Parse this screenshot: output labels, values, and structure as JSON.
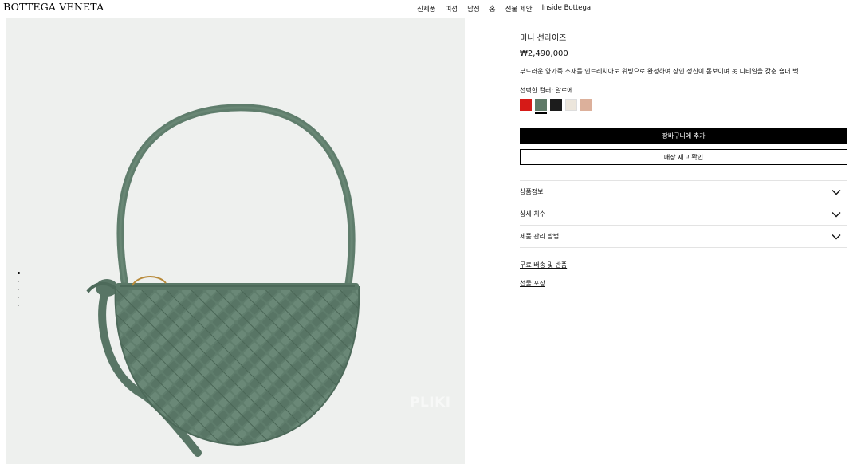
{
  "header": {
    "logo": "BOTTEGA VENETA",
    "nav": [
      "신제품",
      "여성",
      "남성",
      "홈",
      "선물 제안",
      "Inside Bottega"
    ]
  },
  "gallery": {
    "watermark": "PLIKI",
    "slide_count": 5,
    "active_slide": 1
  },
  "product": {
    "name": "미니 선라이즈",
    "price": "₩2,490,000",
    "description": "부드러운 양가죽 소재를 인트레치아토 위빙으로 완성하여 장인 정신이 돋보이며 놋 디테일을 갖춘 숄더 백.",
    "selected_color_label": "선택한 컬러: 알로에",
    "swatches": [
      {
        "name": "red",
        "color": "#d61a17",
        "selected": false
      },
      {
        "name": "aloe",
        "color": "#5f7a68",
        "selected": true
      },
      {
        "name": "black",
        "color": "#1c1c1c",
        "selected": false
      },
      {
        "name": "off-white",
        "color": "#ece6dc",
        "selected": false
      },
      {
        "name": "blush",
        "color": "#dcb09b",
        "selected": false
      }
    ],
    "add_to_cart": "장바구니에 추가",
    "check_store": "매장 재고 확인"
  },
  "accordion": [
    "상품정보",
    "상세 치수",
    "제품 관리 방법"
  ],
  "links": [
    "무료 배송 및 반품",
    "선물 포장"
  ],
  "colors": {
    "bag": "#5f7d6c",
    "bag_dark": "#4d6a5a",
    "background": "#eef0ee"
  }
}
